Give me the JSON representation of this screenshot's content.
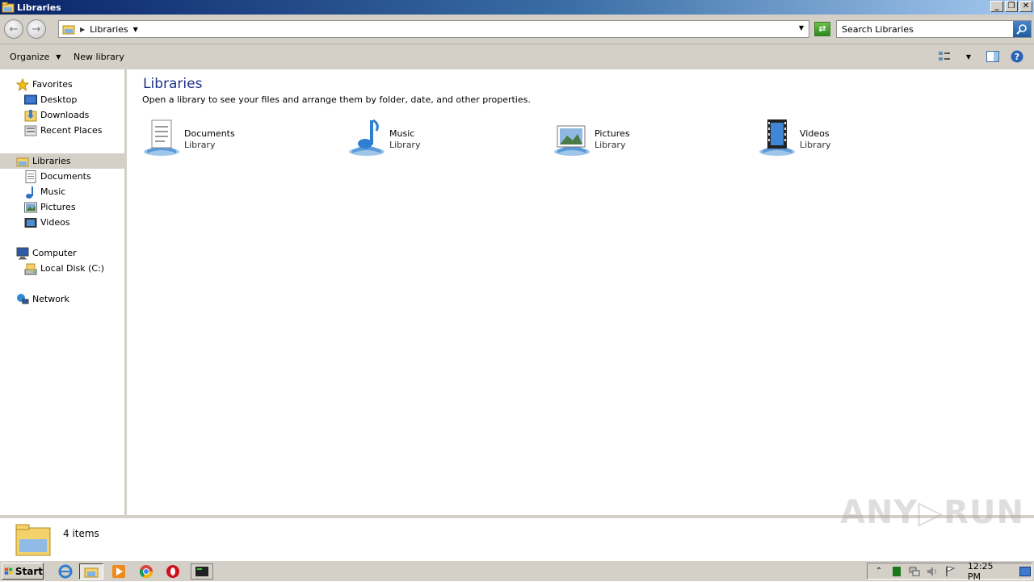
{
  "window": {
    "title": "Libraries",
    "controls": {
      "minimize": "_",
      "restore": "❐",
      "close": "✕"
    }
  },
  "address": {
    "crumbs": [
      "Libraries"
    ],
    "search_placeholder": "Search Libraries"
  },
  "toolbar": {
    "organize_label": "Organize",
    "new_library_label": "New library"
  },
  "nav": {
    "favorites": {
      "label": "Favorites",
      "items": [
        {
          "label": "Desktop",
          "icon": "desktop-icon"
        },
        {
          "label": "Downloads",
          "icon": "downloads-icon"
        },
        {
          "label": "Recent Places",
          "icon": "recent-places-icon"
        }
      ]
    },
    "libraries": {
      "label": "Libraries",
      "items": [
        {
          "label": "Documents",
          "icon": "documents-icon"
        },
        {
          "label": "Music",
          "icon": "music-icon"
        },
        {
          "label": "Pictures",
          "icon": "pictures-icon"
        },
        {
          "label": "Videos",
          "icon": "videos-icon"
        }
      ]
    },
    "computer": {
      "label": "Computer",
      "items": [
        {
          "label": "Local Disk (C:)",
          "icon": "drive-icon"
        }
      ]
    },
    "network": {
      "label": "Network"
    }
  },
  "content": {
    "title": "Libraries",
    "subtitle": "Open a library to see your files and arrange them by folder, date, and other properties.",
    "libraries": [
      {
        "name": "Documents",
        "type": "Library",
        "icon": "documents-library-icon"
      },
      {
        "name": "Music",
        "type": "Library",
        "icon": "music-library-icon"
      },
      {
        "name": "Pictures",
        "type": "Library",
        "icon": "pictures-library-icon"
      },
      {
        "name": "Videos",
        "type": "Library",
        "icon": "videos-library-icon"
      }
    ]
  },
  "details": {
    "item_count": "4 items"
  },
  "taskbar": {
    "start_label": "Start",
    "clock": "12:25 PM"
  },
  "watermark": "ANY▷RUN",
  "colors": {
    "title_blue": "#0a246a",
    "chrome_gray": "#d4d0c8",
    "heading_blue": "#1e3287"
  }
}
